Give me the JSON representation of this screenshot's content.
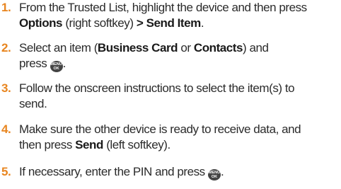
{
  "steps": [
    {
      "number": "1.",
      "line1_prefix": "From the Trusted List, highlight the device and then press",
      "line2_bold1": "Options",
      "line2_mid": " (right softkey) ",
      "line2_bold2": "> Send Item",
      "line2_end": "."
    },
    {
      "number": "2.",
      "line1_prefix": "Select an item (",
      "line1_bold1": "Business Card",
      "line1_mid": " or ",
      "line1_bold2": "Contacts",
      "line1_end": ") and",
      "line2_prefix": "press ",
      "line2_end": "."
    },
    {
      "number": "3.",
      "line1": "Follow the onscreen instructions to select the item(s) to",
      "line2": "send."
    },
    {
      "number": "4.",
      "line1": "Make sure the other device is ready to receive data, and",
      "line2_prefix": "then press ",
      "line2_bold": "Send",
      "line2_end": " (left softkey)."
    },
    {
      "number": "5.",
      "line1_prefix": "If necessary, enter the PIN and press ",
      "line1_end": "."
    }
  ],
  "menu_key": {
    "top": "MENU",
    "bottom": "OK"
  },
  "colors": {
    "number": "#e8851f",
    "text": "#2b2b2b",
    "menu_key": "#444444"
  }
}
